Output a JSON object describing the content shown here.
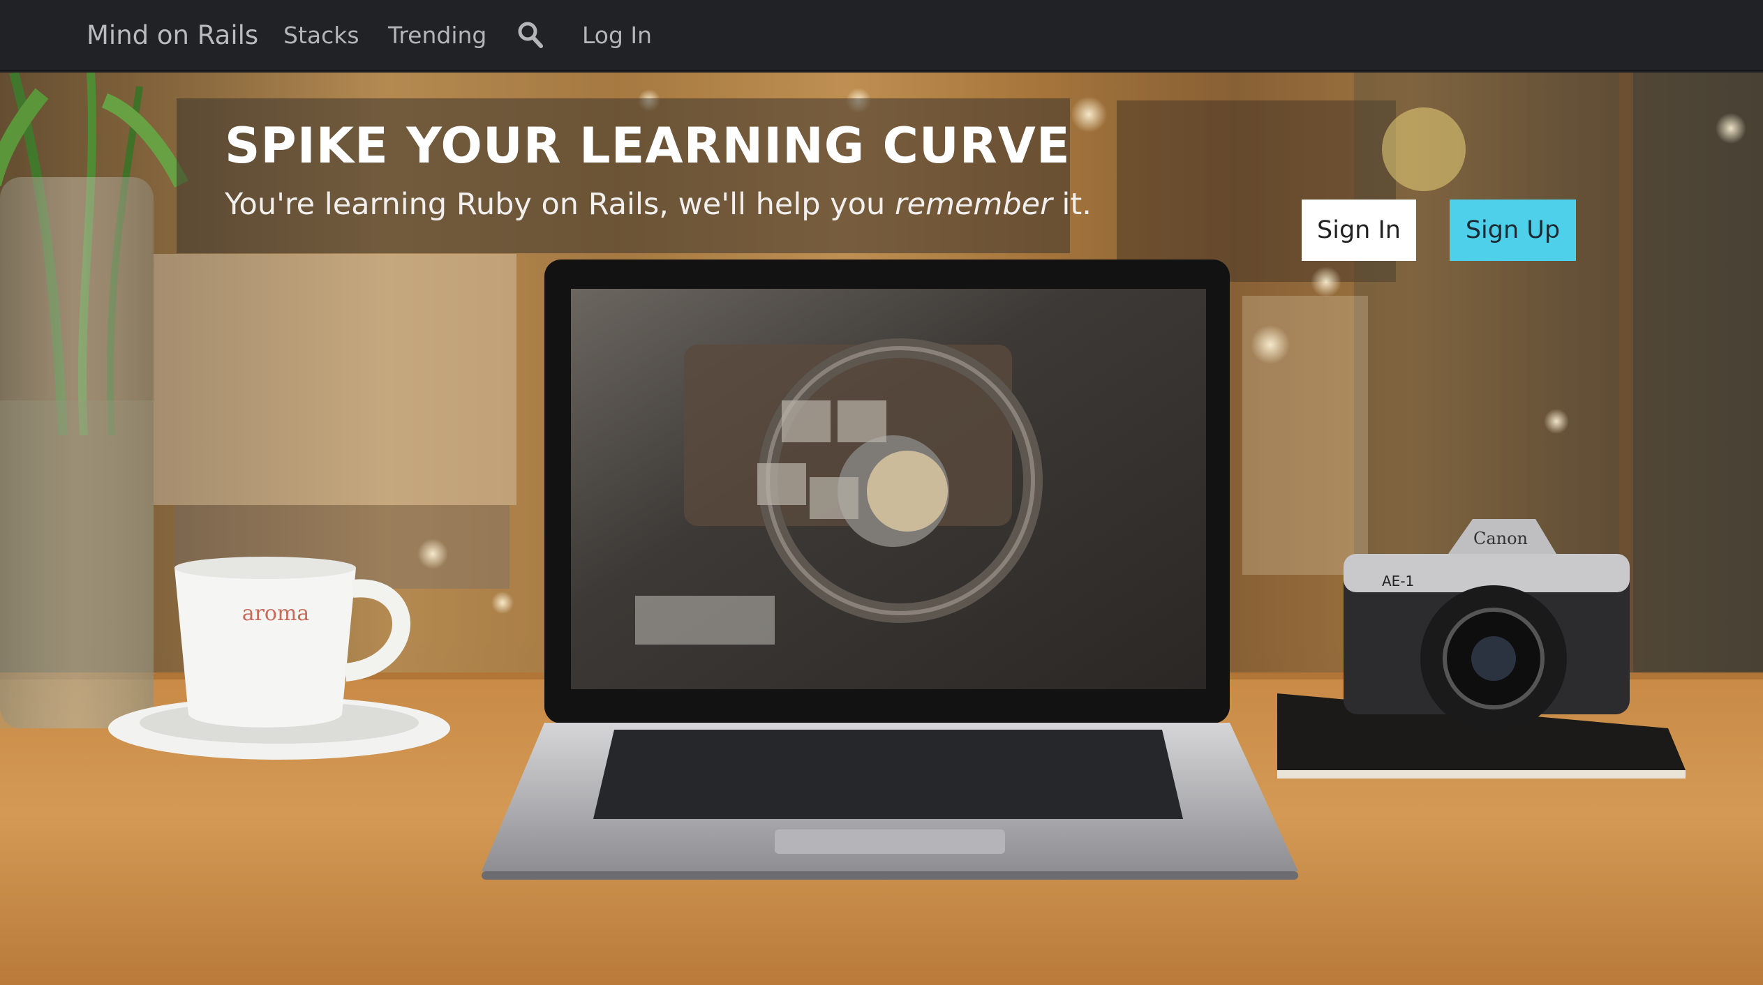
{
  "navbar": {
    "brand": "Mind on Rails",
    "links": {
      "stacks": "Stacks",
      "trending": "Trending",
      "login": "Log In"
    },
    "search_icon": "search-icon"
  },
  "hero": {
    "title": "SPIKE YOUR LEARNING CURVE",
    "subtitle_before": "You're learning Ruby on Rails, we'll help you ",
    "subtitle_emphasis": "remember",
    "subtitle_after": " it.",
    "mug_text": "aroma",
    "camera_brand": "Canon",
    "camera_model": "AE-1"
  },
  "buttons": {
    "sign_in": "Sign In",
    "sign_up": "Sign Up"
  },
  "colors": {
    "navbar_bg": "#212226",
    "signup_accent": "#4fd0ea",
    "signin_bg": "#ffffff"
  }
}
